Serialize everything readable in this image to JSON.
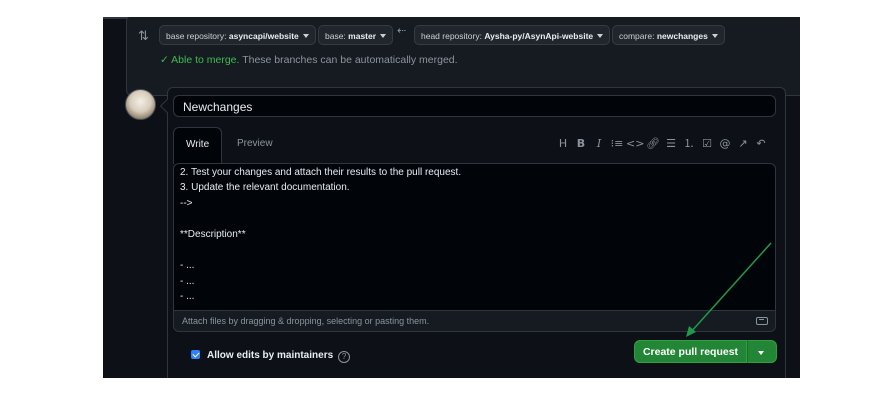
{
  "compare": {
    "base_repo_label": "base repository:",
    "base_repo_value": "asyncapi/website",
    "base_label": "base:",
    "base_value": "master",
    "head_repo_label": "head repository:",
    "head_repo_value": "Aysha-py/AsynApi-website",
    "compare_label": "compare:",
    "compare_value": "newchanges",
    "merge_status": "Able to merge.",
    "merge_message": "These branches can be automatically merged."
  },
  "form": {
    "title_value": "Newchanges",
    "tabs": [
      {
        "label": "Write",
        "active": true
      },
      {
        "label": "Preview",
        "active": false
      }
    ],
    "toolbar_icons": [
      "heading-icon",
      "bold-icon",
      "italic-icon",
      "quote-icon",
      "code-icon",
      "link-icon",
      "unordered-list-icon",
      "ordered-list-icon",
      "task-list-icon",
      "mention-icon",
      "reference-icon",
      "undo-icon"
    ],
    "body_lines": [
      "2. Test your changes and attach their results to the pull request.",
      "3. Update the relevant documentation.",
      "-->",
      "",
      "**Description**",
      "",
      "- ...",
      "- ...",
      "- ..."
    ],
    "attach_text": "Attach files by dragging & dropping, selecting or pasting them.",
    "allow_edits_label": "Allow edits by maintainers",
    "allow_edits_checked": true,
    "help_glyph": "?",
    "create_button_label": "Create pull request"
  },
  "colors": {
    "background": "#0d1117",
    "success": "#3fb950",
    "primary_button": "#238636",
    "annotation_arrow": "#1f9a4d"
  }
}
